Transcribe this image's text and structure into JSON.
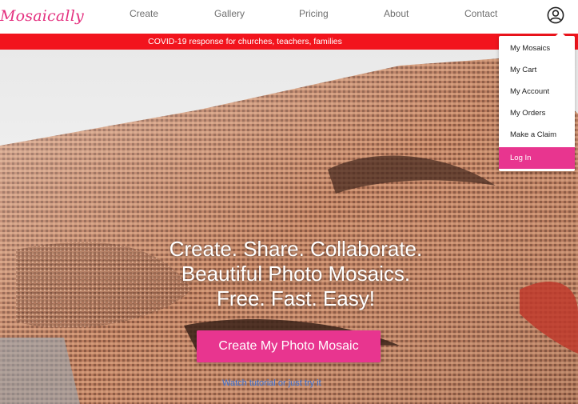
{
  "brand": {
    "logo_text": "Mosaically",
    "color": "#e4307f"
  },
  "nav": {
    "items": [
      {
        "label": "Create"
      },
      {
        "label": "Gallery"
      },
      {
        "label": "Pricing"
      },
      {
        "label": "About"
      },
      {
        "label": "Contact"
      }
    ],
    "account_icon": "user-circle-icon"
  },
  "banner": {
    "text": "COVID-19 response for churches, teachers, families",
    "color": "#f2141d"
  },
  "account_menu": {
    "items": [
      {
        "label": "My Mosaics",
        "active": false
      },
      {
        "label": "My Cart",
        "active": false
      },
      {
        "label": "My Account",
        "active": false
      },
      {
        "label": "My Orders",
        "active": false
      },
      {
        "label": "Make a Claim",
        "active": false
      },
      {
        "label": "Log In",
        "active": true
      }
    ],
    "active_color": "#e8358f"
  },
  "hero": {
    "headline_lines": [
      "Create. Share. Collaborate.",
      "Beautiful Photo Mosaics.",
      "Free. Fast. Easy!"
    ],
    "cta_label": "Create My Photo Mosaic",
    "cta_color": "#e8358f",
    "sublink_text": "Watch tutorial or just try it"
  }
}
